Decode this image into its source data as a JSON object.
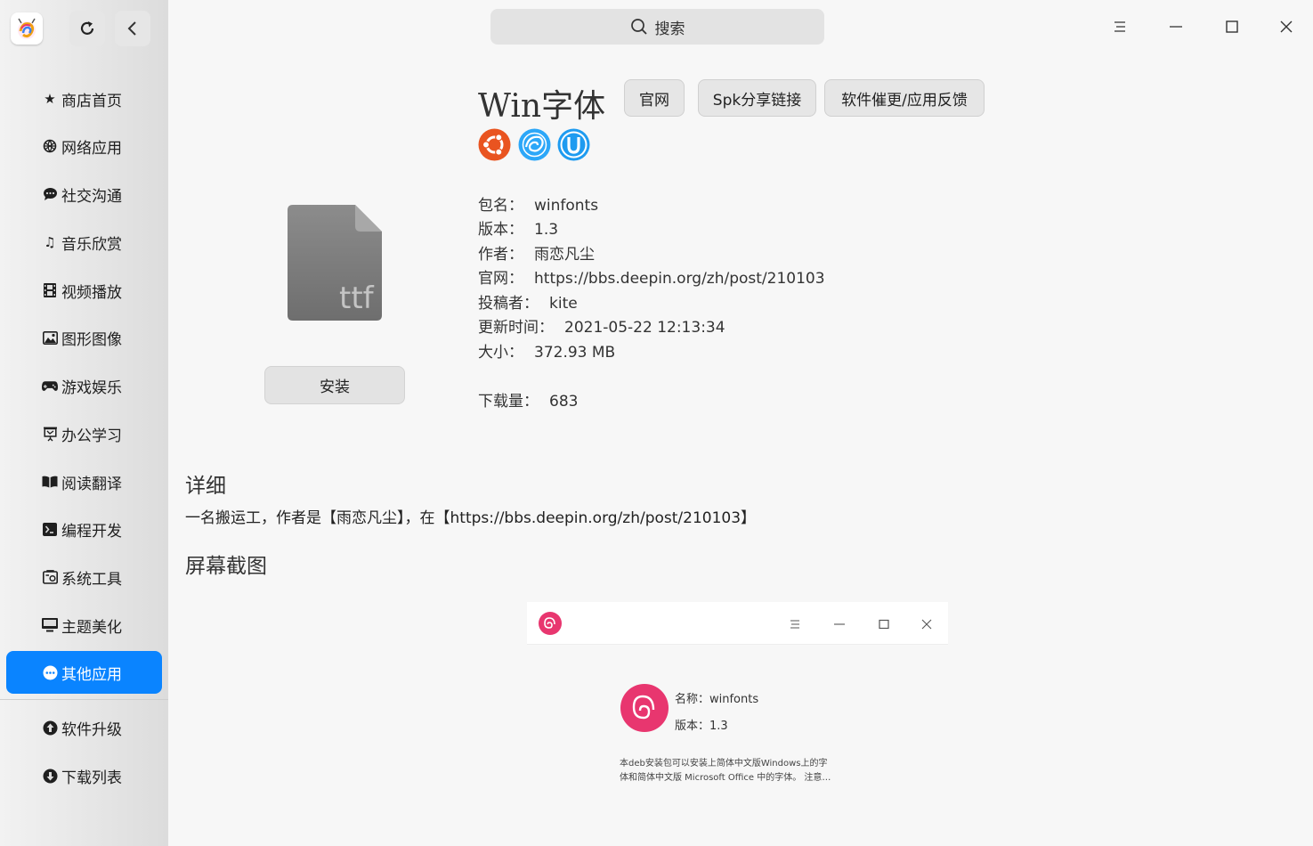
{
  "sidebar": {
    "items": [
      {
        "label": "商店首页",
        "icon": "star-icon"
      },
      {
        "label": "网络应用",
        "icon": "globe-icon"
      },
      {
        "label": "社交沟通",
        "icon": "chat-icon"
      },
      {
        "label": "音乐欣赏",
        "icon": "music-icon"
      },
      {
        "label": "视频播放",
        "icon": "film-icon"
      },
      {
        "label": "图形图像",
        "icon": "image-icon"
      },
      {
        "label": "游戏娱乐",
        "icon": "gamepad-icon"
      },
      {
        "label": "办公学习",
        "icon": "presentation-icon"
      },
      {
        "label": "阅读翻译",
        "icon": "book-icon"
      },
      {
        "label": "编程开发",
        "icon": "terminal-icon"
      },
      {
        "label": "系统工具",
        "icon": "toolbox-icon"
      },
      {
        "label": "主题美化",
        "icon": "monitor-icon"
      },
      {
        "label": "其他应用",
        "icon": "more-icon",
        "active": true
      }
    ],
    "bottom_items": [
      {
        "label": "软件升级",
        "icon": "upgrade-icon"
      },
      {
        "label": "下载列表",
        "icon": "download-icon"
      }
    ]
  },
  "header": {
    "search_label": "搜索"
  },
  "app": {
    "name": "Win字体",
    "buttons": {
      "website": "官网",
      "share": "Spk分享链接",
      "feedback": "软件催更/应用反馈"
    },
    "file_icon_text": "ttf",
    "install_label": "安装",
    "info": {
      "package_key": "包名：",
      "package_val": "winfonts",
      "version_key": "版本：",
      "version_val": "1.3",
      "author_key": "作者：",
      "author_val": "雨恋凡尘",
      "site_key": "官网：",
      "site_val": "https://bbs.deepin.org/zh/post/210103",
      "contributor_key": "投稿者：",
      "contributor_val": "kite",
      "updated_key": "更新时间：",
      "updated_val": "2021-05-22 12:13:34",
      "size_key": "大小：",
      "size_val": "372.93 MB",
      "downloads_key": "下载量：",
      "downloads_val": "683"
    }
  },
  "details": {
    "heading": "详细",
    "text": "一名搬运工，作者是【雨恋凡尘】，在【https://bbs.deepin.org/zh/post/210103】"
  },
  "screenshots": {
    "heading": "屏幕截图",
    "shot": {
      "name_line": "名称：winfonts",
      "version_line": "版本：1.3",
      "desc_line1": "本deb安装包可以安装上简体中文版Windows上的字",
      "desc_line2": "体和简体中文版 Microsoft Office 中的字体。     注意…"
    }
  },
  "colors": {
    "accent": "#0a84ff",
    "ubuntu": "#e95420",
    "deepin": "#2ca7f8",
    "uos": "#1e9bf0",
    "debian": "#e8366f"
  }
}
